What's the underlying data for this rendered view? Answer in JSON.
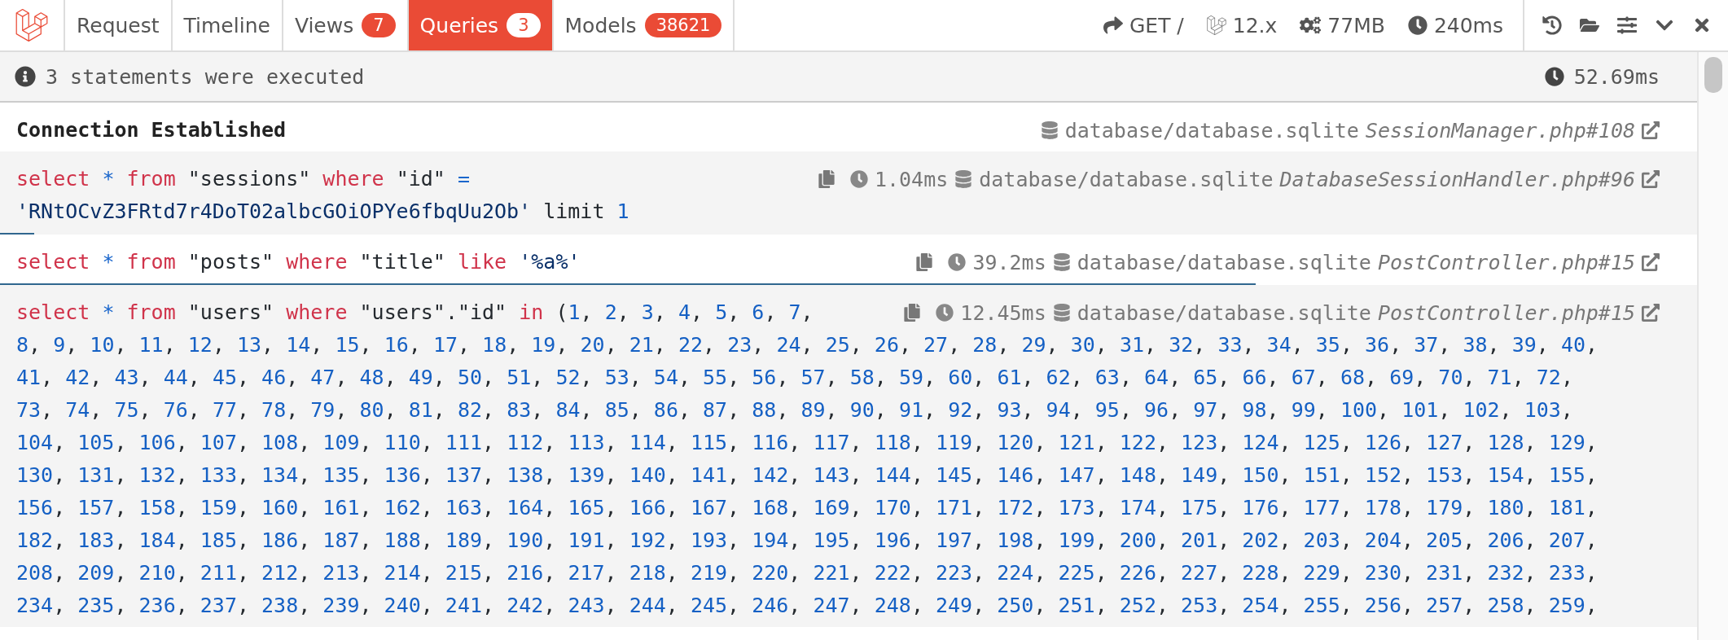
{
  "header": {
    "tabs": [
      {
        "label": "Request",
        "selected": false
      },
      {
        "label": "Timeline",
        "selected": false
      },
      {
        "label": "Views",
        "badge": "7",
        "selected": false
      },
      {
        "label": "Queries",
        "badge": "3",
        "selected": true
      },
      {
        "label": "Models",
        "badge": "38621",
        "selected": false
      }
    ],
    "status": [
      {
        "kind": "method",
        "text": "GET /"
      },
      {
        "kind": "version",
        "text": "12.x"
      },
      {
        "kind": "memory",
        "text": "77MB"
      },
      {
        "kind": "time",
        "text": "240ms"
      }
    ],
    "actions": [
      {
        "kind": "history"
      },
      {
        "kind": "open"
      },
      {
        "kind": "settings"
      },
      {
        "kind": "minimize"
      },
      {
        "kind": "close"
      }
    ]
  },
  "summary": {
    "text": "3 statements were executed",
    "duration": "52.69ms"
  },
  "connection": {
    "label": "Connection Established",
    "database": "database/database.sqlite",
    "source": "SessionManager.php#108"
  },
  "queries": [
    {
      "duration": "1.04ms",
      "database": "database/database.sqlite",
      "source": "DatabaseSessionHandler.php#96",
      "level": 0.02,
      "lines": [
        [
          {
            "kind": "keyword",
            "text": "select"
          },
          {
            "kind": "operator",
            "text": "*"
          },
          {
            "kind": "keyword",
            "text": "from"
          },
          {
            "kind": "plain",
            "text": "\"sessions\""
          },
          {
            "kind": "keyword",
            "text": "where"
          },
          {
            "kind": "plain",
            "text": "\"id\""
          },
          {
            "kind": "operator",
            "text": "="
          }
        ],
        [
          {
            "kind": "string",
            "text": "'RNtOCvZ3FRtd7r4DoT02albcGOiOPYe6fbqUu2Ob'"
          },
          {
            "kind": "plain",
            "text": "limit"
          },
          {
            "kind": "numbers",
            "text": "1"
          }
        ]
      ]
    },
    {
      "duration": "39.2ms",
      "database": "database/database.sqlite",
      "source": "PostController.php#15",
      "level": 0.74,
      "lines": [
        [
          {
            "kind": "keyword",
            "text": "select"
          },
          {
            "kind": "operator",
            "text": "*"
          },
          {
            "kind": "keyword",
            "text": "from"
          },
          {
            "kind": "plain",
            "text": "\"posts\""
          },
          {
            "kind": "keyword",
            "text": "where"
          },
          {
            "kind": "plain",
            "text": "\"title\""
          },
          {
            "kind": "keyword",
            "text": "like"
          },
          {
            "kind": "string",
            "text": "'%a%'"
          }
        ]
      ]
    },
    {
      "duration": "12.45ms",
      "database": "database/database.sqlite",
      "source": "PostController.php#15",
      "lines": [
        [
          {
            "kind": "keyword",
            "text": "select"
          },
          {
            "kind": "operator",
            "text": "*"
          },
          {
            "kind": "keyword",
            "text": "from"
          },
          {
            "kind": "plain",
            "text": "\"users\""
          },
          {
            "kind": "keyword",
            "text": "where"
          },
          {
            "kind": "plain",
            "text": "\"users\".\"id\""
          },
          {
            "kind": "keyword",
            "text": "in"
          },
          {
            "kind": "numbers",
            "text": "(1, 2, 3, 4, 5, 6, 7,"
          }
        ],
        [
          {
            "kind": "numbers",
            "text": "8, 9, 10, 11, 12, 13, 14, 15, 16, 17, 18, 19, 20, 21, 22, 23, 24, 25, 26, 27, 28, 29, 30, 31, 32, 33, 34, 35, 36, 37, 38, 39, 40,"
          }
        ],
        [
          {
            "kind": "numbers",
            "text": "41, 42, 43, 44, 45, 46, 47, 48, 49, 50, 51, 52, 53, 54, 55, 56, 57, 58, 59, 60, 61, 62, 63, 64, 65, 66, 67, 68, 69, 70, 71, 72,"
          }
        ],
        [
          {
            "kind": "numbers",
            "text": "73, 74, 75, 76, 77, 78, 79, 80, 81, 82, 83, 84, 85, 86, 87, 88, 89, 90, 91, 92, 93, 94, 95, 96, 97, 98, 99, 100, 101, 102, 103,"
          }
        ],
        [
          {
            "kind": "numbers",
            "text": "104, 105, 106, 107, 108, 109, 110, 111, 112, 113, 114, 115, 116, 117, 118, 119, 120, 121, 122, 123, 124, 125, 126, 127, 128, 129,"
          }
        ],
        [
          {
            "kind": "numbers",
            "text": "130, 131, 132, 133, 134, 135, 136, 137, 138, 139, 140, 141, 142, 143, 144, 145, 146, 147, 148, 149, 150, 151, 152, 153, 154, 155,"
          }
        ],
        [
          {
            "kind": "numbers",
            "text": "156, 157, 158, 159, 160, 161, 162, 163, 164, 165, 166, 167, 168, 169, 170, 171, 172, 173, 174, 175, 176, 177, 178, 179, 180, 181,"
          }
        ],
        [
          {
            "kind": "numbers",
            "text": "182, 183, 184, 185, 186, 187, 188, 189, 190, 191, 192, 193, 194, 195, 196, 197, 198, 199, 200, 201, 202, 203, 204, 205, 206, 207,"
          }
        ],
        [
          {
            "kind": "numbers",
            "text": "208, 209, 210, 211, 212, 213, 214, 215, 216, 217, 218, 219, 220, 221, 222, 223, 224, 225, 226, 227, 228, 229, 230, 231, 232, 233,"
          }
        ],
        [
          {
            "kind": "numbers",
            "text": "234, 235, 236, 237, 238, 239, 240, 241, 242, 243, 244, 245, 246, 247, 248, 249, 250, 251, 252, 253, 254, 255, 256, 257, 258, 259,"
          }
        ]
      ]
    }
  ]
}
